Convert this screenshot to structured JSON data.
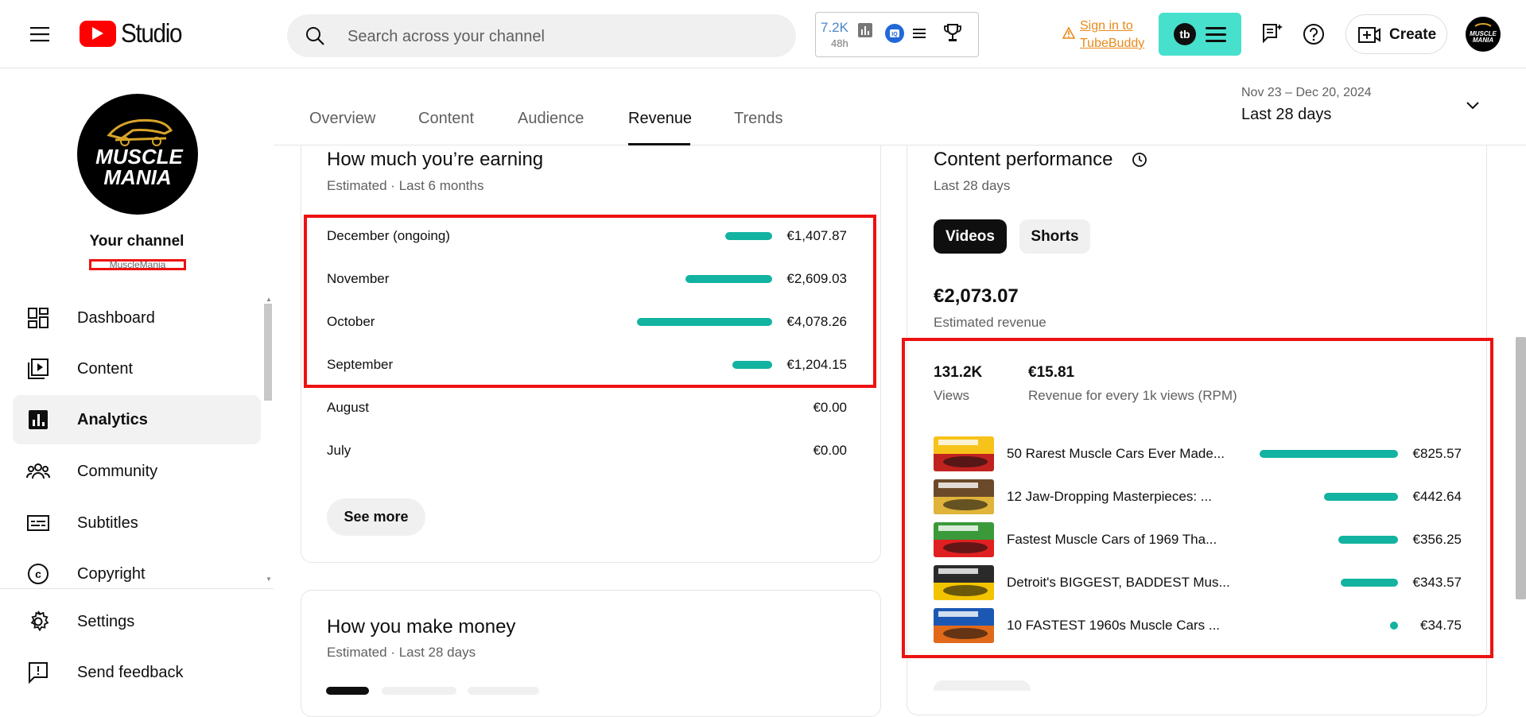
{
  "header": {
    "logo_text": "Studio",
    "search_placeholder": "Search across your channel",
    "ext_views": "7.2K",
    "ext_period": "48h",
    "tubebuddy_sign_in": "Sign in to",
    "tubebuddy_name": "TubeBuddy",
    "create_label": "Create"
  },
  "sidebar": {
    "channel_logo_top": "MUSCLE",
    "channel_logo_bottom": "MANIA",
    "channel_label": "Your channel",
    "channel_handle": "MuscleMania",
    "items": [
      {
        "label": "Dashboard",
        "icon": "dashboard-icon"
      },
      {
        "label": "Content",
        "icon": "content-icon"
      },
      {
        "label": "Analytics",
        "icon": "analytics-icon",
        "active": true
      },
      {
        "label": "Community",
        "icon": "community-icon"
      },
      {
        "label": "Subtitles",
        "icon": "subtitles-icon"
      },
      {
        "label": "Copyright",
        "icon": "copyright-icon"
      }
    ],
    "bottom_items": [
      {
        "label": "Settings",
        "icon": "gear-icon"
      },
      {
        "label": "Send feedback",
        "icon": "feedback-icon"
      }
    ]
  },
  "tabs": [
    "Overview",
    "Content",
    "Audience",
    "Revenue",
    "Trends"
  ],
  "active_tab": "Revenue",
  "date_range": {
    "range": "Nov 23 – Dec 20, 2024",
    "label": "Last 28 days"
  },
  "earning": {
    "title": "How much you’re earning",
    "subtitle": "Estimated · Last 6 months",
    "rows": [
      {
        "month": "December (ongoing)",
        "value": "€1,407.87",
        "amount": 1407.87
      },
      {
        "month": "November",
        "value": "€2,609.03",
        "amount": 2609.03
      },
      {
        "month": "October",
        "value": "€4,078.26",
        "amount": 4078.26
      },
      {
        "month": "September",
        "value": "€1,204.15",
        "amount": 1204.15
      },
      {
        "month": "August",
        "value": "€0.00",
        "amount": 0
      },
      {
        "month": "July",
        "value": "€0.00",
        "amount": 0
      }
    ],
    "see_more": "See more"
  },
  "make_money": {
    "title": "How you make money",
    "subtitle": "Estimated · Last 28 days"
  },
  "performance": {
    "title": "Content performance",
    "subtitle": "Last 28 days",
    "tab_videos": "Videos",
    "tab_shorts": "Shorts",
    "revenue": "€2,073.07",
    "revenue_label": "Estimated revenue",
    "views": "131.2K",
    "views_label": "Views",
    "rpm": "€15.81",
    "rpm_label": "Revenue for every 1k views (RPM)",
    "videos": [
      {
        "title": "50 Rarest Muscle Cars Ever Made...",
        "value": "€825.57",
        "amount": 825.57
      },
      {
        "title": "12 Jaw-Dropping Masterpieces: ...",
        "value": "€442.64",
        "amount": 442.64
      },
      {
        "title": "Fastest Muscle Cars of 1969 Tha...",
        "value": "€356.25",
        "amount": 356.25
      },
      {
        "title": "Detroit's BIGGEST, BADDEST Mus...",
        "value": "€343.57",
        "amount": 343.57
      },
      {
        "title": "10 FASTEST 1960s Muscle Cars ...",
        "value": "€34.75",
        "amount": 34.75
      }
    ]
  },
  "colors": {
    "accent_bar": "#12b3a0",
    "highlight_box": "#ee1111",
    "logo_red": "#ff0000",
    "tubebuddy": "#47e0cd"
  }
}
